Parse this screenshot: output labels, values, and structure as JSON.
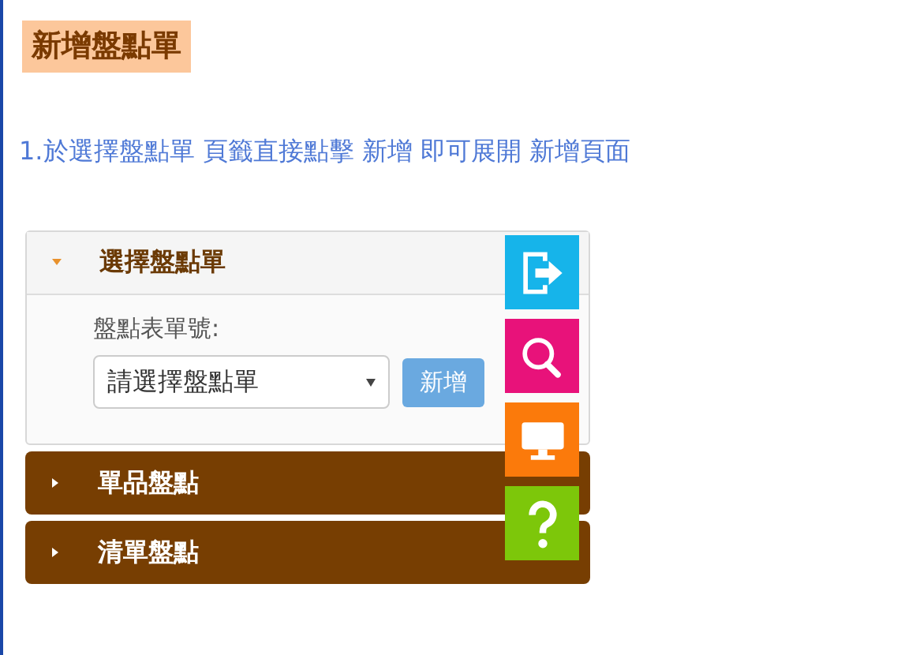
{
  "heading": "新增盤點單",
  "instruction": "1.於選擇盤點單 頁籤直接點擊 新增 即可展開 新增頁面",
  "sections": [
    {
      "title": "選擇盤點單",
      "expanded": true,
      "field_label": "盤點表單號:",
      "select": {
        "value": "請選擇盤點單"
      },
      "button": "新增"
    },
    {
      "title": "單品盤點",
      "expanded": false
    },
    {
      "title": "清單盤點",
      "expanded": false
    }
  ],
  "side_buttons": [
    {
      "kind": "exit"
    },
    {
      "kind": "search"
    },
    {
      "kind": "monitor"
    },
    {
      "kind": "help"
    }
  ]
}
